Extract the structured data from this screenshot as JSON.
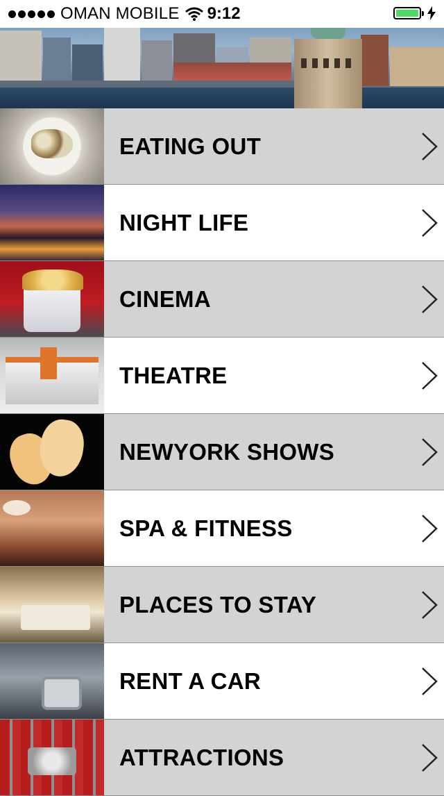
{
  "status_bar": {
    "carrier": "OMAN MOBILE",
    "time": "9:12",
    "signal_bars": 5,
    "battery_level": 1.0,
    "battery_color": "#4cd964"
  },
  "banner": {
    "icon": "new-york-skyline-image"
  },
  "menu": {
    "items": [
      {
        "label": "EATING OUT",
        "icon": "eating-out-image"
      },
      {
        "label": "NIGHT LIFE",
        "icon": "night-life-image"
      },
      {
        "label": "CINEMA",
        "icon": "cinema-image"
      },
      {
        "label": "THEATRE",
        "icon": "theatre-image"
      },
      {
        "label": "NEWYORK SHOWS",
        "icon": "theatre-masks-image"
      },
      {
        "label": "SPA & FITNESS",
        "icon": "spa-image"
      },
      {
        "label": "PLACES TO STAY",
        "icon": "hotel-room-image"
      },
      {
        "label": "RENT A CAR",
        "icon": "car-key-image"
      },
      {
        "label": "ATTRACTIONS",
        "icon": "attractions-image"
      }
    ],
    "row_colors": {
      "alt": "#d3d3d3",
      "normal": "#ffffff"
    },
    "chevron_icon": "chevron-right-icon"
  }
}
